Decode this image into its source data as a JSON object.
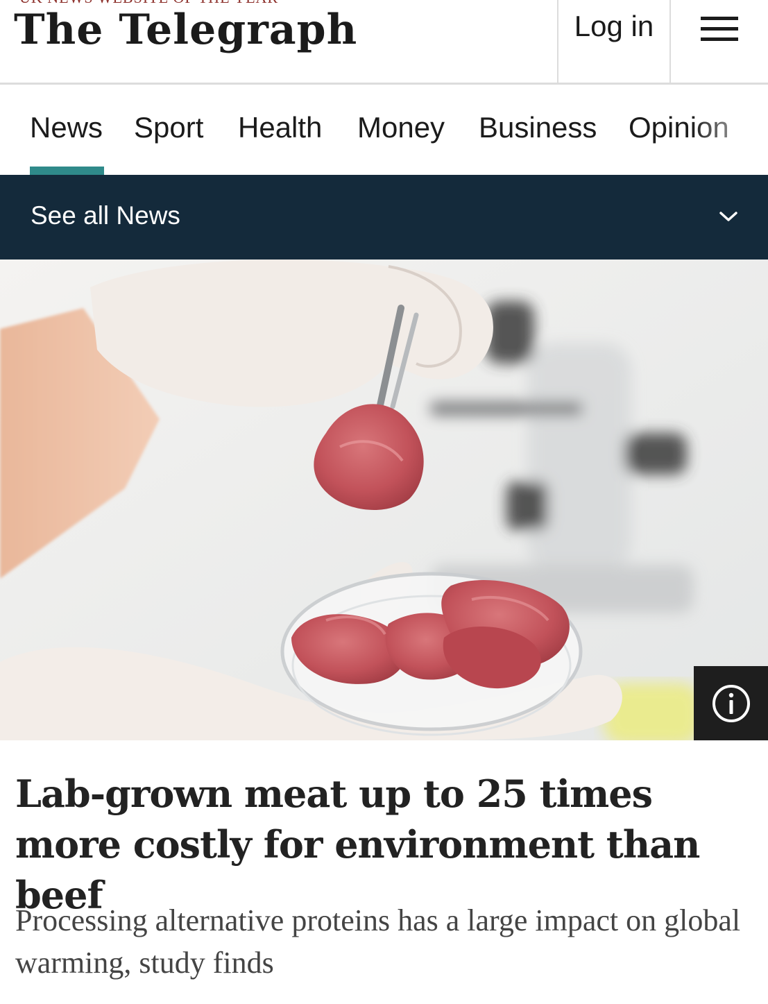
{
  "masthead": {
    "tagline": "UK NEWS WEBSITE OF THE YEAR",
    "logo_text": "The Telegraph",
    "login_label": "Log in",
    "menu_icon": "hamburger-menu-icon"
  },
  "nav": {
    "tabs": [
      {
        "label": "News",
        "active": true
      },
      {
        "label": "Sport",
        "active": false
      },
      {
        "label": "Health",
        "active": false
      },
      {
        "label": "Money",
        "active": false
      },
      {
        "label": "Business",
        "active": false
      },
      {
        "label": "Opinion",
        "active": false
      }
    ],
    "active_color": "#2f8a8a"
  },
  "section_bar": {
    "label": "See all News",
    "icon": "chevron-down-icon",
    "background": "#142a3b"
  },
  "hero": {
    "info_icon": "info-icon"
  },
  "article": {
    "headline": "Lab-grown meat up to 25 times more costly for environment than beef",
    "standfirst": "Processing alternative proteins has a large impact on global warming, study finds"
  }
}
